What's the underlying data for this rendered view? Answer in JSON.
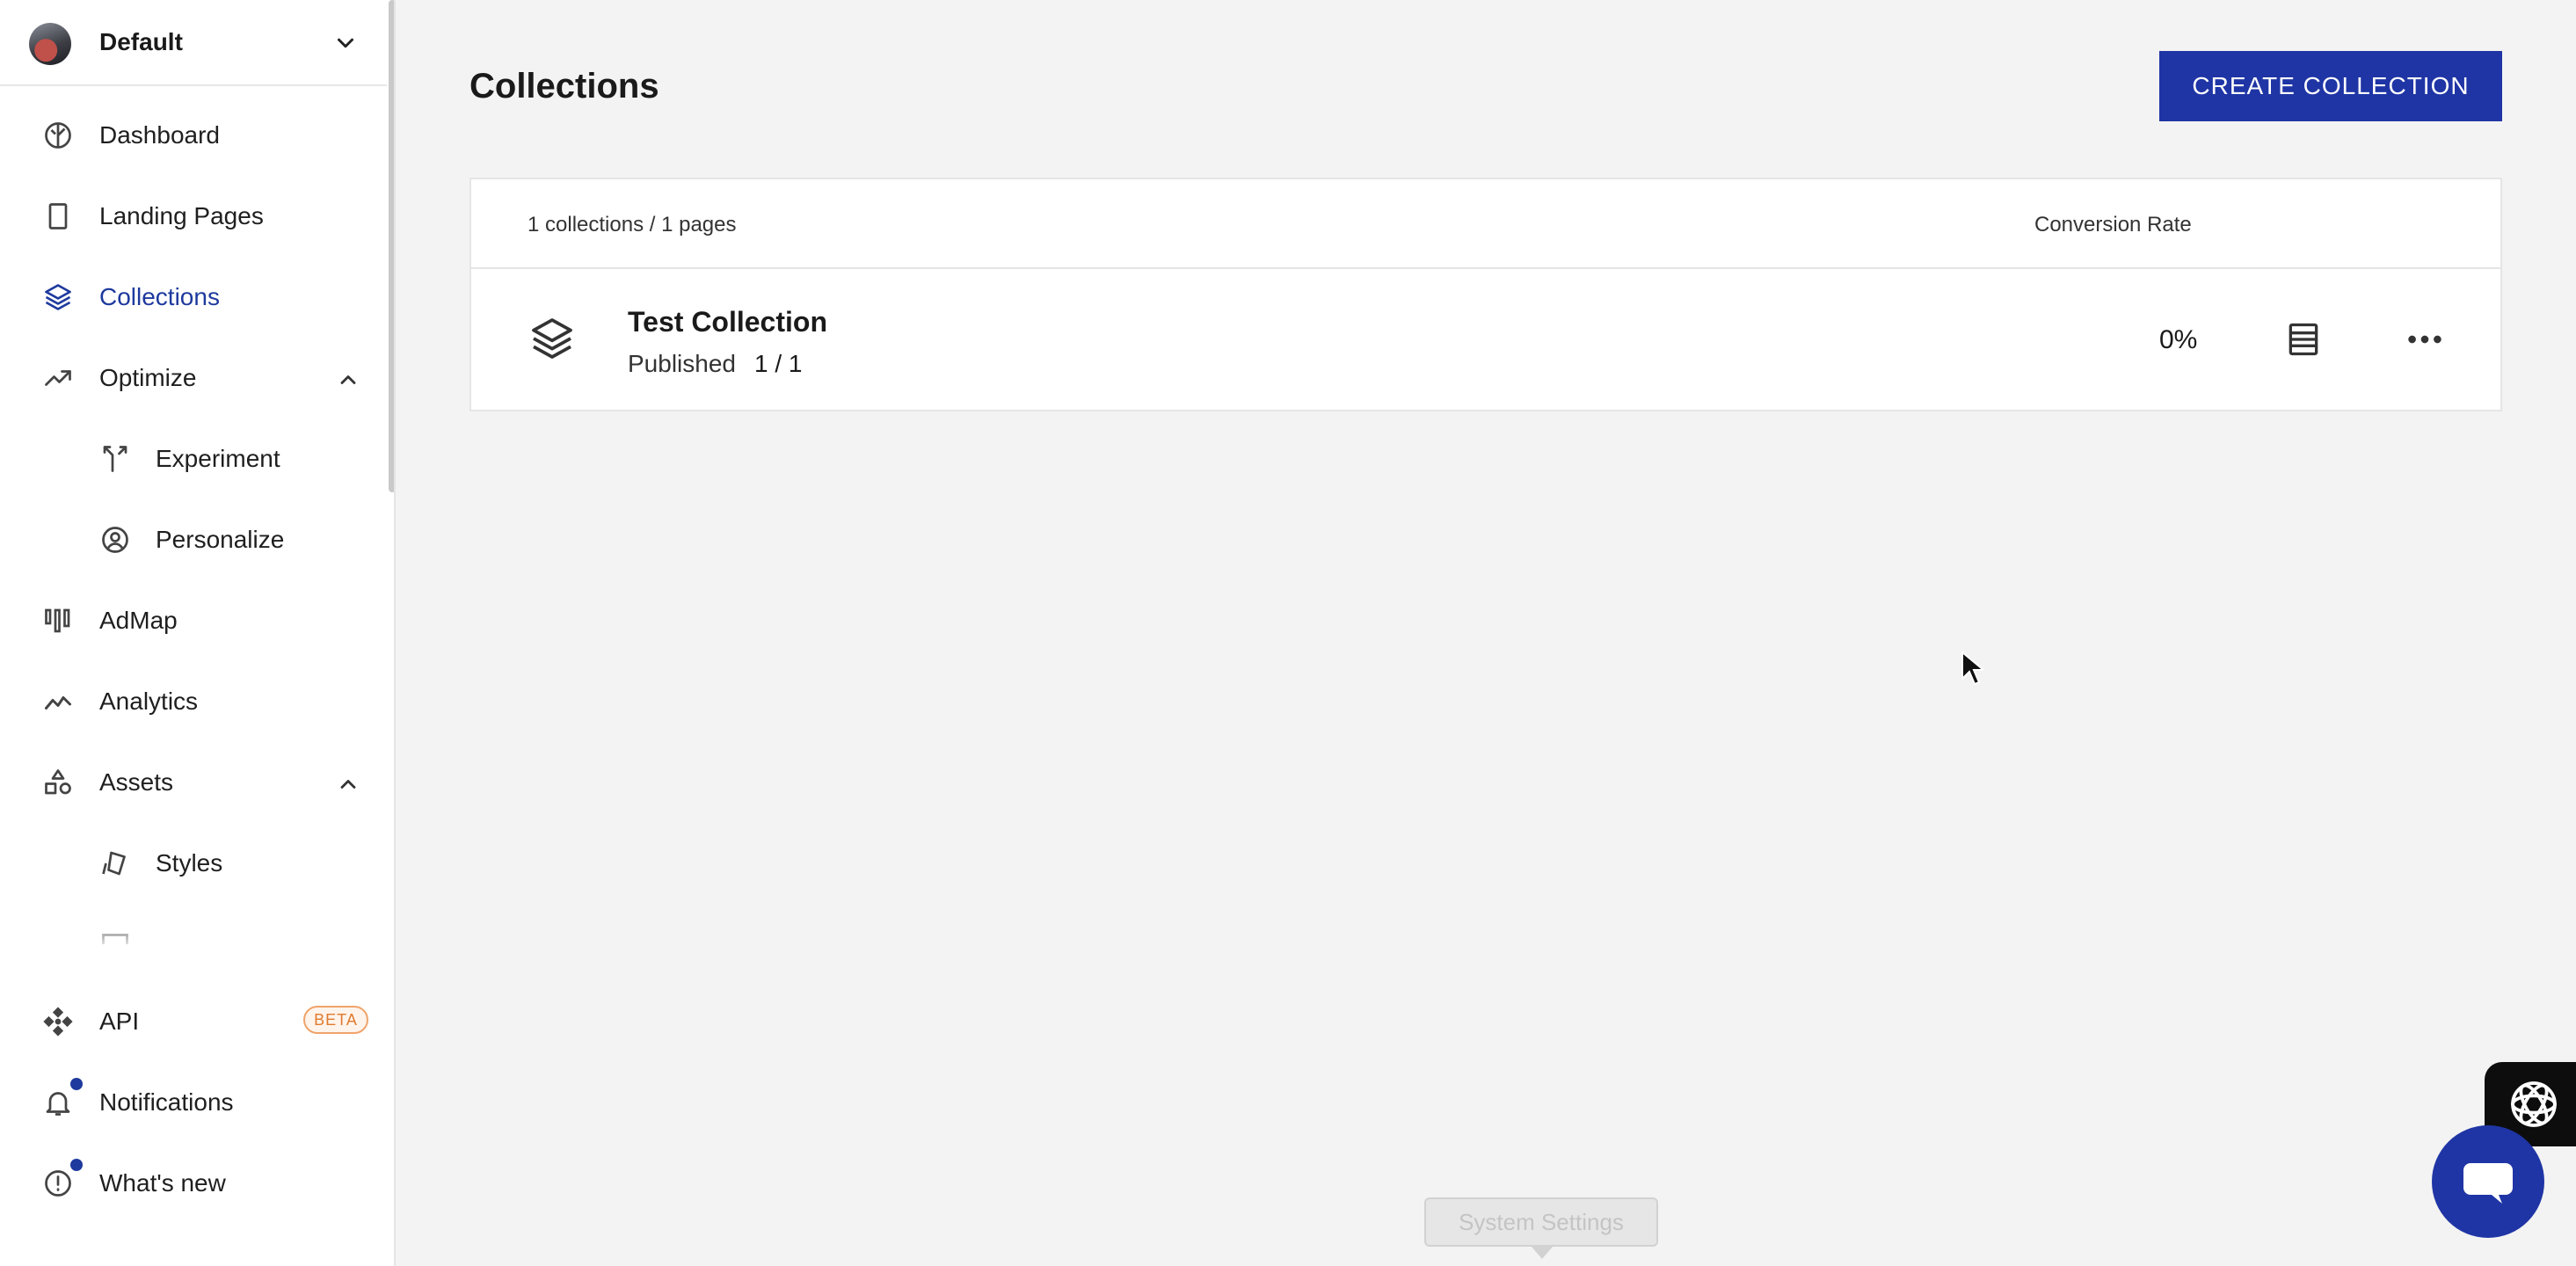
{
  "workspace": {
    "name": "Default"
  },
  "sidebar": {
    "items": [
      {
        "id": "dashboard",
        "label": "Dashboard",
        "icon": "dashboard-icon"
      },
      {
        "id": "landing-pages",
        "label": "Landing Pages",
        "icon": "page-icon"
      },
      {
        "id": "collections",
        "label": "Collections",
        "icon": "layers-icon",
        "active": true
      },
      {
        "id": "optimize",
        "label": "Optimize",
        "icon": "trending-up-icon",
        "expanded": true
      },
      {
        "id": "experiment",
        "label": "Experiment",
        "icon": "split-arrows-icon",
        "parent": "optimize"
      },
      {
        "id": "personalize",
        "label": "Personalize",
        "icon": "user-circle-icon",
        "parent": "optimize"
      },
      {
        "id": "admap",
        "label": "AdMap",
        "icon": "bars-icon"
      },
      {
        "id": "analytics",
        "label": "Analytics",
        "icon": "line-chart-icon"
      },
      {
        "id": "assets",
        "label": "Assets",
        "icon": "shapes-icon",
        "expanded": true
      },
      {
        "id": "styles",
        "label": "Styles",
        "icon": "brush-icon",
        "parent": "assets"
      },
      {
        "id": "forms",
        "label": "",
        "icon": "form-icon",
        "parent": "assets"
      },
      {
        "id": "api",
        "label": "API",
        "icon": "api-icon",
        "badge": "BETA"
      },
      {
        "id": "notifications",
        "label": "Notifications",
        "icon": "bell-icon"
      },
      {
        "id": "whats-new",
        "label": "What's new",
        "icon": "alert-circle-icon"
      }
    ]
  },
  "main": {
    "title": "Collections",
    "create_button": "CREATE COLLECTION",
    "table": {
      "summary": "1 collections / 1 pages",
      "columns": {
        "conversion_rate": "Conversion Rate"
      },
      "rows": [
        {
          "name": "Test Collection",
          "status": "Published",
          "count": "1 / 1",
          "conversion_rate": "0%"
        }
      ]
    }
  },
  "tooltip": {
    "text": "System Settings"
  },
  "colors": {
    "accent": "#1f35a5",
    "active_nav": "#1e3a9e",
    "beta_badge": "#e07a2e",
    "background": "#f3f3f3"
  }
}
